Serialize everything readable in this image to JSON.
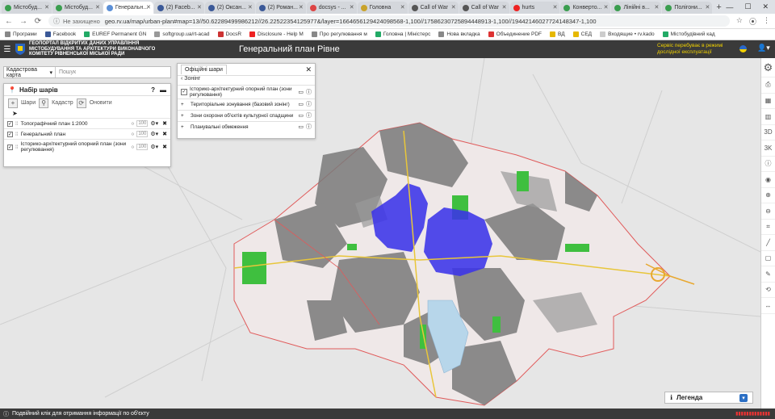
{
  "browser": {
    "tabs": [
      {
        "label": "Містобуд...",
        "color": "#3a9e4f"
      },
      {
        "label": "Містобуд...",
        "color": "#3a9e4f"
      },
      {
        "label": "Генеральн...",
        "color": "#5b8fd6",
        "active": true
      },
      {
        "label": "(2) Faceb...",
        "color": "#3b5998"
      },
      {
        "label": "(2) Оксан...",
        "color": "#3b5998"
      },
      {
        "label": "(2) Роман...",
        "color": "#3b5998"
      },
      {
        "label": "docsys - ...",
        "color": "#d44"
      },
      {
        "label": "Головна",
        "color": "#c9a32a"
      },
      {
        "label": "Call of War",
        "color": "#555"
      },
      {
        "label": "Call of War",
        "color": "#555"
      },
      {
        "label": "hurts",
        "color": "#e22"
      },
      {
        "label": "Конверто...",
        "color": "#3a9e4f"
      },
      {
        "label": "Лінійні в...",
        "color": "#3a9e4f"
      },
      {
        "label": "Полігони...",
        "color": "#3a9e4f"
      }
    ],
    "address": {
      "secure_label": "Не захищено",
      "url": "geo.rv.ua/map/urban-plan#map=13//50.62289499986212//26.22522354125977&/layer=1664656129424098568-1,100//17586230725894448913-1,100//19442146027724148347-1,100"
    },
    "bookmarks": [
      {
        "label": "Програми",
        "color": "#888"
      },
      {
        "label": "Facebook",
        "color": "#3b5998"
      },
      {
        "label": "EUREF Permanent GN",
        "color": "#2a6"
      },
      {
        "label": "softgroup.ua/rt-acad",
        "color": "#999"
      },
      {
        "label": "DocsR",
        "color": "#c33"
      },
      {
        "label": "Disclosure - Help M",
        "color": "#e22"
      },
      {
        "label": "Про регулювання м",
        "color": "#888"
      },
      {
        "label": "Головна | Міністерс",
        "color": "#2a6"
      },
      {
        "label": "Нова вкладка",
        "color": "#888"
      },
      {
        "label": "Объединение PDF",
        "color": "#d33"
      },
      {
        "label": "ВД",
        "color": "#e6b800"
      },
      {
        "label": "СЕД",
        "color": "#e6b800"
      },
      {
        "label": "Входящие • rv.kado",
        "color": "#ccc"
      },
      {
        "label": "Містобудівний кад",
        "color": "#2a6"
      }
    ]
  },
  "header": {
    "org_line1": "ГЕОПОРТАЛ ВІДКРИТИХ ДАНИХ УПРАВЛІННЯ",
    "org_line2": "МІСТОБУДУВАННЯ ТА АРХІТЕКТУРИ ВИКОНАВЧОГО",
    "org_line3": "КОМІТЕТУ РІВНЕНСЬКОЇ МІСЬКОЇ РАДИ",
    "title": "Генеральний план Рівне",
    "service_note": "Сервіс перебуває в режимі дослідної експлуатації"
  },
  "search": {
    "select_label": "Кадастрова карта",
    "placeholder": "Пошук"
  },
  "layer_panel": {
    "title": "Набір шарів",
    "help": "?",
    "tools": {
      "layers": "Шари",
      "cadastre": "Кадастр",
      "refresh": "Оновити"
    },
    "layers": [
      {
        "name": "Топографічний план 1:2000",
        "opacity": "100"
      },
      {
        "name": "Генеральний план",
        "opacity": "100"
      },
      {
        "name": "Історико-архітектурний опорний план (зони регулювання)",
        "opacity": "100"
      }
    ]
  },
  "official_panel": {
    "tab": "Офіційні шари",
    "back_label": "Зонінг",
    "rows": [
      {
        "name": "Історико-архітектурний опорний план (зони регулювання)",
        "checked": true
      },
      {
        "name": "Територіальне зонування (базовий зонінг)",
        "checked": false
      },
      {
        "name": "Зони охорони об'єктів культурної спадщини",
        "checked": false
      },
      {
        "name": "Планувальні обмеження",
        "checked": false
      }
    ]
  },
  "legend": {
    "label": "Легенда"
  },
  "status": {
    "text": "Подвійний клік для отримання інформації по об'єкту"
  },
  "right_tools": [
    {
      "icon": "print-icon",
      "glyph": "⎙"
    },
    {
      "icon": "chart-icon",
      "glyph": "▦"
    },
    {
      "icon": "book-icon",
      "glyph": "▥"
    },
    {
      "icon": "3d-icon",
      "glyph": "3D"
    },
    {
      "icon": "3k-icon",
      "glyph": "3K"
    },
    {
      "icon": "info-icon",
      "glyph": "ⓘ"
    },
    {
      "icon": "compass-icon",
      "glyph": "◉"
    },
    {
      "icon": "zoom-in-icon",
      "glyph": "⊕"
    },
    {
      "icon": "zoom-out-icon",
      "glyph": "⊖"
    },
    {
      "icon": "crop-icon",
      "glyph": "⌗"
    },
    {
      "icon": "ruler-icon",
      "glyph": "╱"
    },
    {
      "icon": "frame-icon",
      "glyph": "▢"
    },
    {
      "icon": "pin-icon",
      "glyph": "✎"
    },
    {
      "icon": "sync-icon",
      "glyph": "⟲"
    },
    {
      "icon": "width-icon",
      "glyph": "↔"
    }
  ]
}
